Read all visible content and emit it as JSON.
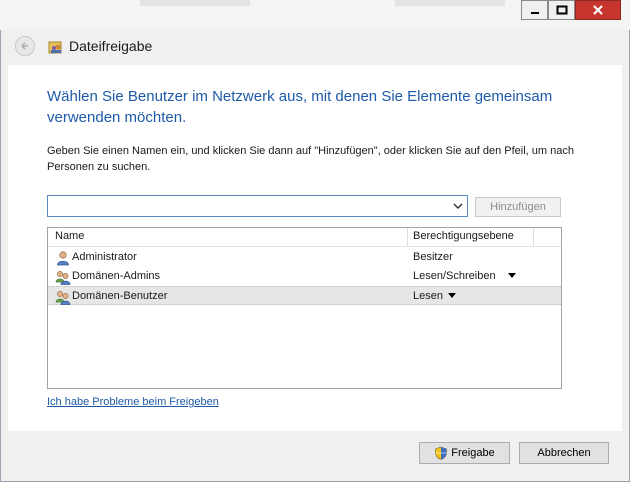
{
  "window": {
    "title": "Dateifreigabe",
    "controls": {
      "minimize": "minimize",
      "maximize": "maximize",
      "close": "close"
    }
  },
  "main": {
    "heading": "Wählen Sie Benutzer im Netzwerk aus, mit denen Sie Elemente gemeinsam verwenden möchten.",
    "instruction": "Geben Sie einen Namen ein, und klicken Sie dann auf \"Hinzufügen\", oder klicken Sie auf den Pfeil, um nach Personen zu suchen.",
    "name_input": {
      "value": "",
      "placeholder": ""
    },
    "add_button": "Hinzufügen",
    "table": {
      "columns": [
        "Name",
        "Berechtigungsebene"
      ],
      "rows": [
        {
          "name": "Administrator",
          "permission": "Besitzer",
          "icon": "user-icon",
          "has_dropdown": false
        },
        {
          "name": "Domänen-Admins",
          "permission": "Lesen/Schreiben",
          "icon": "group-icon",
          "has_dropdown": true
        },
        {
          "name": "Domänen-Benutzer",
          "permission": "Lesen",
          "icon": "group-icon",
          "has_dropdown": true,
          "selected": true
        }
      ]
    },
    "help_link": "Ich habe Probleme beim Freigeben"
  },
  "footer": {
    "share_button": "Freigabe",
    "cancel_button": "Abbrechen"
  },
  "colors": {
    "heading": "#1d5aa8",
    "link": "#1d5aa8",
    "close_button": "#c7362d",
    "selected_row": "#e6e6e6"
  }
}
